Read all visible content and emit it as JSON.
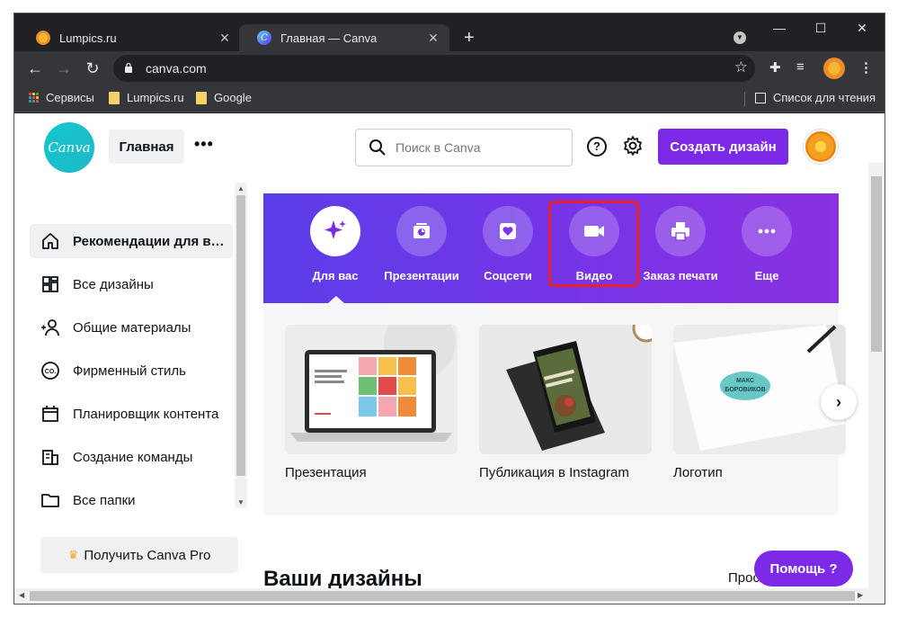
{
  "browser": {
    "tabs": [
      {
        "title": "Lumpics.ru",
        "icon": "orange-slice-favicon",
        "active": false
      },
      {
        "title": "Главная — Canva",
        "icon": "canva-favicon",
        "active": true
      }
    ],
    "new_tab_label": "+",
    "url": "canva.com",
    "bookmarks": [
      {
        "label": "Сервисы",
        "icon": "apps-grid-icon"
      },
      {
        "label": "Lumpics.ru",
        "icon": "folder-icon"
      },
      {
        "label": "Google",
        "icon": "folder-icon"
      }
    ],
    "reading_list_label": "Список для чтения"
  },
  "header": {
    "logo_text": "Canva",
    "home_label": "Главная",
    "more_label": "•••",
    "search_placeholder": "Поиск в Canva",
    "help_symbol": "?",
    "create_label": "Создать дизайн"
  },
  "sidebar": {
    "items": [
      {
        "label": "Рекомендации для вас",
        "icon": "home-icon",
        "active": true
      },
      {
        "label": "Все дизайны",
        "icon": "grid-icon",
        "active": false
      },
      {
        "label": "Общие материалы",
        "icon": "people-icon",
        "active": false
      },
      {
        "label": "Фирменный стиль",
        "icon": "brand-icon",
        "active": false
      },
      {
        "label": "Планировщик контента",
        "icon": "calendar-icon",
        "active": false
      },
      {
        "label": "Создание команды",
        "icon": "building-icon",
        "active": false
      },
      {
        "label": "Все папки",
        "icon": "folder-icon",
        "active": false
      }
    ],
    "pro_label": "Получить Canva Pro"
  },
  "categories": [
    {
      "label": "Для вас",
      "icon": "sparkle-icon",
      "selected": true
    },
    {
      "label": "Презентации",
      "icon": "presentation-icon",
      "selected": false
    },
    {
      "label": "Соцсети",
      "icon": "heart-icon",
      "selected": false
    },
    {
      "label": "Видео",
      "icon": "video-camera-icon",
      "selected": false,
      "highlighted": true
    },
    {
      "label": "Заказ печати",
      "icon": "printer-icon",
      "selected": false
    },
    {
      "label": "Еще",
      "icon": "more-dots-icon",
      "selected": false
    }
  ],
  "templates": [
    {
      "label": "Презентация"
    },
    {
      "label": "Публикация в Instagram"
    },
    {
      "label": "Логотип"
    }
  ],
  "next_arrow": "›",
  "designs_title": "Ваши дизайны",
  "see_all_label": "Просмотреть все",
  "help_button": "Помощь  ?",
  "colors": {
    "brand_purple": "#7d2ae8",
    "hero_gradient_start": "#5b3ee8",
    "canva_teal": "#12c7cf",
    "highlight_red": "#e8202a"
  }
}
